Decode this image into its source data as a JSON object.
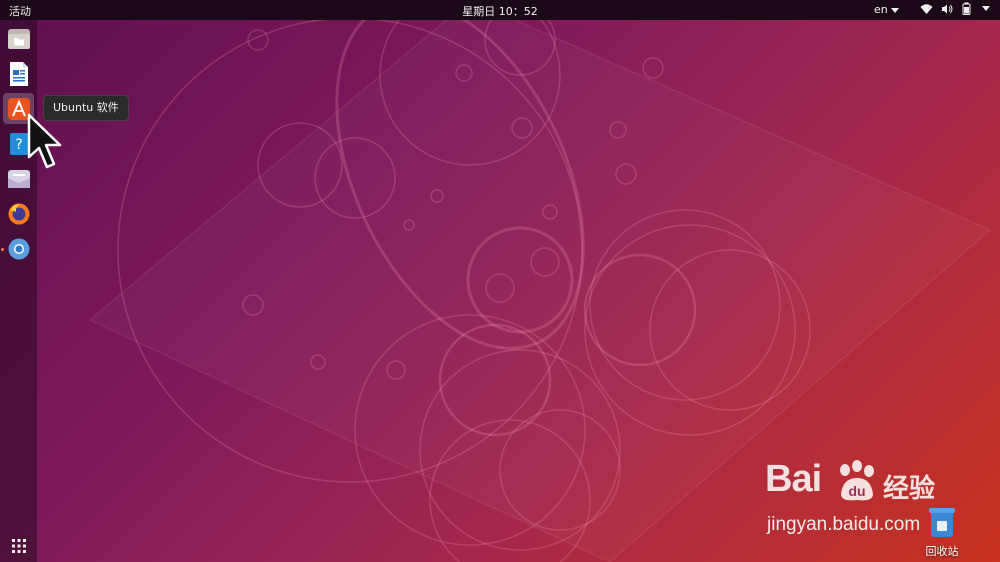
{
  "topbar": {
    "activities": "活动",
    "clock": "星期日 10：52",
    "language": "en"
  },
  "dock": {
    "items": [
      {
        "name": "files",
        "icon": "files-icon"
      },
      {
        "name": "libreoffice-writer",
        "icon": "writer-icon"
      },
      {
        "name": "ubuntu-software",
        "icon": "ubuntu-software-icon",
        "active": true
      },
      {
        "name": "help",
        "icon": "help-icon"
      },
      {
        "name": "messages",
        "icon": "mail-icon"
      },
      {
        "name": "firefox",
        "icon": "firefox-icon"
      },
      {
        "name": "chromium",
        "icon": "chromium-icon",
        "running": true
      }
    ],
    "tooltip": "Ubuntu 软件"
  },
  "desktop": {
    "trash_label": "回收站"
  },
  "watermark": {
    "brand": "Bai",
    "brand_cn": "经验",
    "url": "jingyan.baidu.com"
  },
  "colors": {
    "topbar": "#1c0917",
    "accent": "#e95420",
    "wallpaper_start": "#5e0f4f",
    "wallpaper_end": "#c8321f"
  }
}
